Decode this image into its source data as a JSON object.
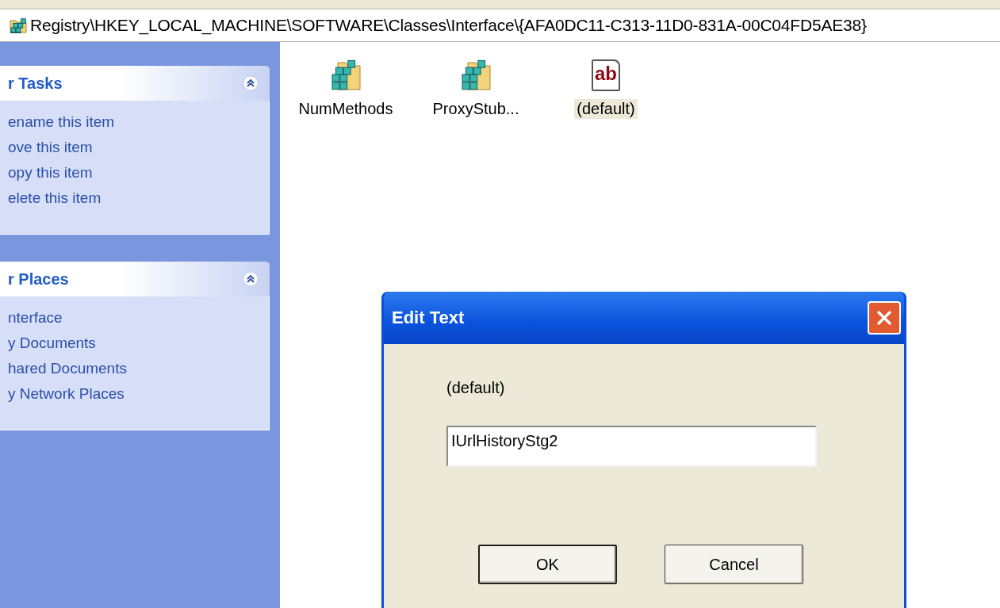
{
  "address_bar": {
    "path": "Registry\\HKEY_LOCAL_MACHINE\\SOFTWARE\\Classes\\Interface\\{AFA0DC11-C313-11D0-831A-00C04FD5AE38}"
  },
  "sidebar": {
    "panels": [
      {
        "title": "r Tasks",
        "expanded": true,
        "items": [
          "ename this item",
          "ove this item",
          "opy this item",
          "elete this item"
        ]
      },
      {
        "title": "r Places",
        "expanded": true,
        "items": [
          "nterface",
          "y Documents",
          "hared Documents",
          "y Network Places"
        ]
      }
    ]
  },
  "items": [
    {
      "name": "NumMethods",
      "kind": "binary",
      "selected": false
    },
    {
      "name": "ProxyStub...",
      "kind": "binary",
      "selected": false
    },
    {
      "name": "(default)",
      "kind": "string",
      "icon_text": "ab",
      "selected": true
    }
  ],
  "dialog": {
    "title": "Edit Text",
    "label": "(default)",
    "value": "IUrlHistoryStg2",
    "buttons": [
      "OK",
      "Cancel"
    ]
  }
}
